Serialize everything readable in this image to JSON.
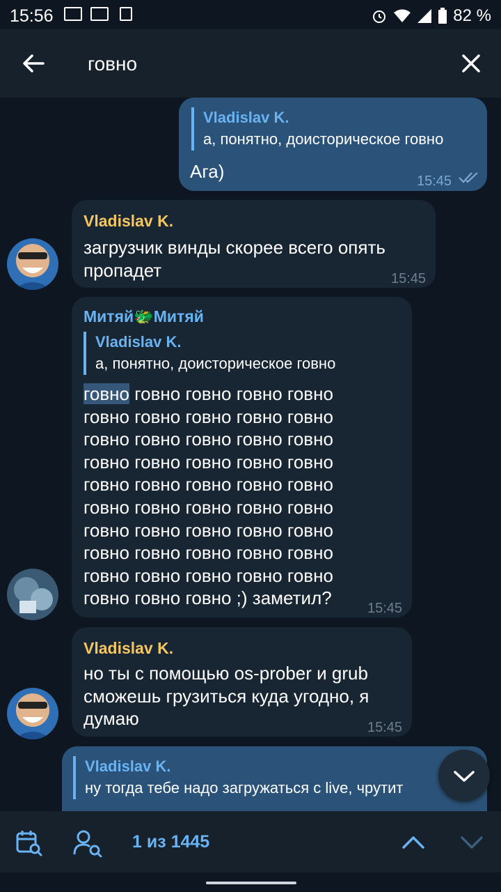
{
  "status_bar": {
    "time": "15:56",
    "battery": "82 %"
  },
  "header": {
    "search_query": "говно"
  },
  "messages": {
    "m1": {
      "reply_name": "Vladislav K.",
      "reply_text": "а, понятно, доисторическое говно",
      "text": "Ага)",
      "time": "15:45"
    },
    "m2": {
      "sender": "Vladislav K.",
      "line1": "загрузчик винды скорее всего опять",
      "line2": "пропадет",
      "time": "15:45"
    },
    "m3": {
      "sender": "Митяй🐲Митяй",
      "reply_name": "Vladislav K.",
      "reply_text": "а, понятно, доисторическое говно",
      "highlight": "говно",
      "line1_rest": " говно говно говно говно",
      "line2": "говно говно говно говно говно",
      "line3": "говно говно говно говно говно",
      "line4": "говно говно говно говно говно",
      "line5": "говно говно говно говно говно",
      "line6": "говно говно говно говно говно",
      "line7": "говно говно говно говно говно",
      "line8": "говно говно говно говно говно",
      "line9": "говно говно говно говно говно",
      "line10": "говно говно говно ;) заметил?",
      "time": "15:45"
    },
    "m4": {
      "sender": "Vladislav K.",
      "line1": "но ты с помощью os-prober и grub",
      "line2": "сможешь грузиться куда угодно, я",
      "line3": "думаю",
      "time": "15:45"
    },
    "m5": {
      "reply_name": "Vladislav K.",
      "reply_text": "ну тогда тебе надо загружаться с live, чрутит"
    }
  },
  "bottom_bar": {
    "counter": "1 из 1445"
  },
  "colors": {
    "background": "#0e1621",
    "bar": "#17212b",
    "incoming": "#182533",
    "outgoing": "#2b5278",
    "accent": "#6ab3f3",
    "sender_vladislav": "#f5c661"
  },
  "icons": [
    "back-arrow-icon",
    "close-icon",
    "calendar-search-icon",
    "user-search-icon",
    "chevron-up-icon",
    "chevron-down-icon",
    "scroll-down-icon",
    "read-checks-icon",
    "alarm-icon",
    "wifi-icon",
    "signal-icon",
    "battery-icon",
    "gmail-icon"
  ]
}
